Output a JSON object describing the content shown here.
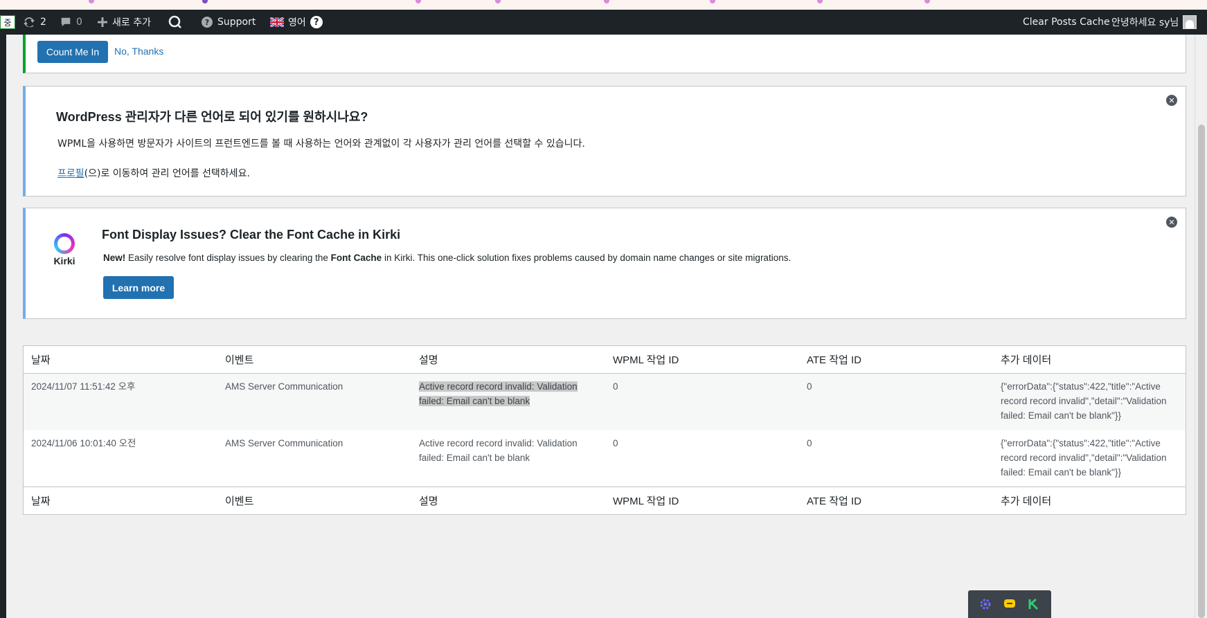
{
  "adminbar": {
    "lang_chip": "중",
    "updates_count": "2",
    "comments_count": "0",
    "new_label": "새로 추가",
    "support_label": "Support",
    "language_label": "영어",
    "help_glyph": "?",
    "clear_cache_label": "Clear Posts Cache",
    "greeting": "안녕하세요 sy님"
  },
  "notice_top": {
    "count_me_in": "Count Me In",
    "no_thanks": "No, Thanks"
  },
  "notice_wpml": {
    "title": "WordPress 관리자가 다른 언어로 되어 있기를 원하시나요?",
    "para1": "WPML을 사용하면 방문자가 사이트의 프런트엔드를 볼 때 사용하는 언어와 관계없이 각 사용자가 관리 언어를 선택할 수 있습니다.",
    "profile_link": "프로필",
    "para2_rest": "(으)로 이동하여 관리 언어를 선택하세요."
  },
  "notice_kirki": {
    "logo_text": "Kirki",
    "title": "Font Display Issues? Clear the Font Cache in Kirki",
    "desc_new": "New!",
    "desc_a": " Easily resolve font display issues by clearing the ",
    "desc_bold": "Font Cache",
    "desc_b": " in Kirki. This one-click solution fixes problems caused by domain name changes or site migrations.",
    "learn_more": "Learn more"
  },
  "table": {
    "headers": [
      "날짜",
      "이벤트",
      "설명",
      "WPML 작업 ID",
      "ATE 작업 ID",
      "추가 데이터"
    ],
    "rows": [
      {
        "date": "2024/11/07 11:51:42 오후",
        "event": "AMS Server Communication",
        "desc_line1": "Active record record invalid: Validation",
        "desc_line2": "failed: Email can't be blank",
        "wpml_id": "0",
        "ate_id": "0",
        "extra_line1": "{\"errorData\":{\"status\":422,\"title\":\"Active",
        "extra_line2": "record record invalid\",\"detail\":\"Validation",
        "extra_line3": "failed: Email can't be blank\"}}"
      },
      {
        "date": "2024/11/06 10:01:40 오전",
        "event": "AMS Server Communication",
        "desc_line1": "Active record record invalid: Validation",
        "desc_line2": "failed: Email can't be blank",
        "wpml_id": "0",
        "ate_id": "0",
        "extra_line1": "{\"errorData\":{\"status\":422,\"title\":\"Active",
        "extra_line2": "record record invalid\",\"detail\":\"Validation",
        "extra_line3": "failed: Email can't be blank\"}}"
      }
    ]
  },
  "icons": {
    "updates": "refresh-icon",
    "comments": "comment-icon",
    "new": "plus-icon",
    "support": "help-icon",
    "flag": "uk-flag-icon",
    "dismiss": "dismiss-icon",
    "float1": "gear-icon",
    "float2": "chat-icon",
    "float3": "k-icon"
  },
  "colors": {
    "primary": "#2271b1",
    "adminbar": "#1d2327",
    "success_border": "#00a32a",
    "info_border": "#72aee6"
  }
}
